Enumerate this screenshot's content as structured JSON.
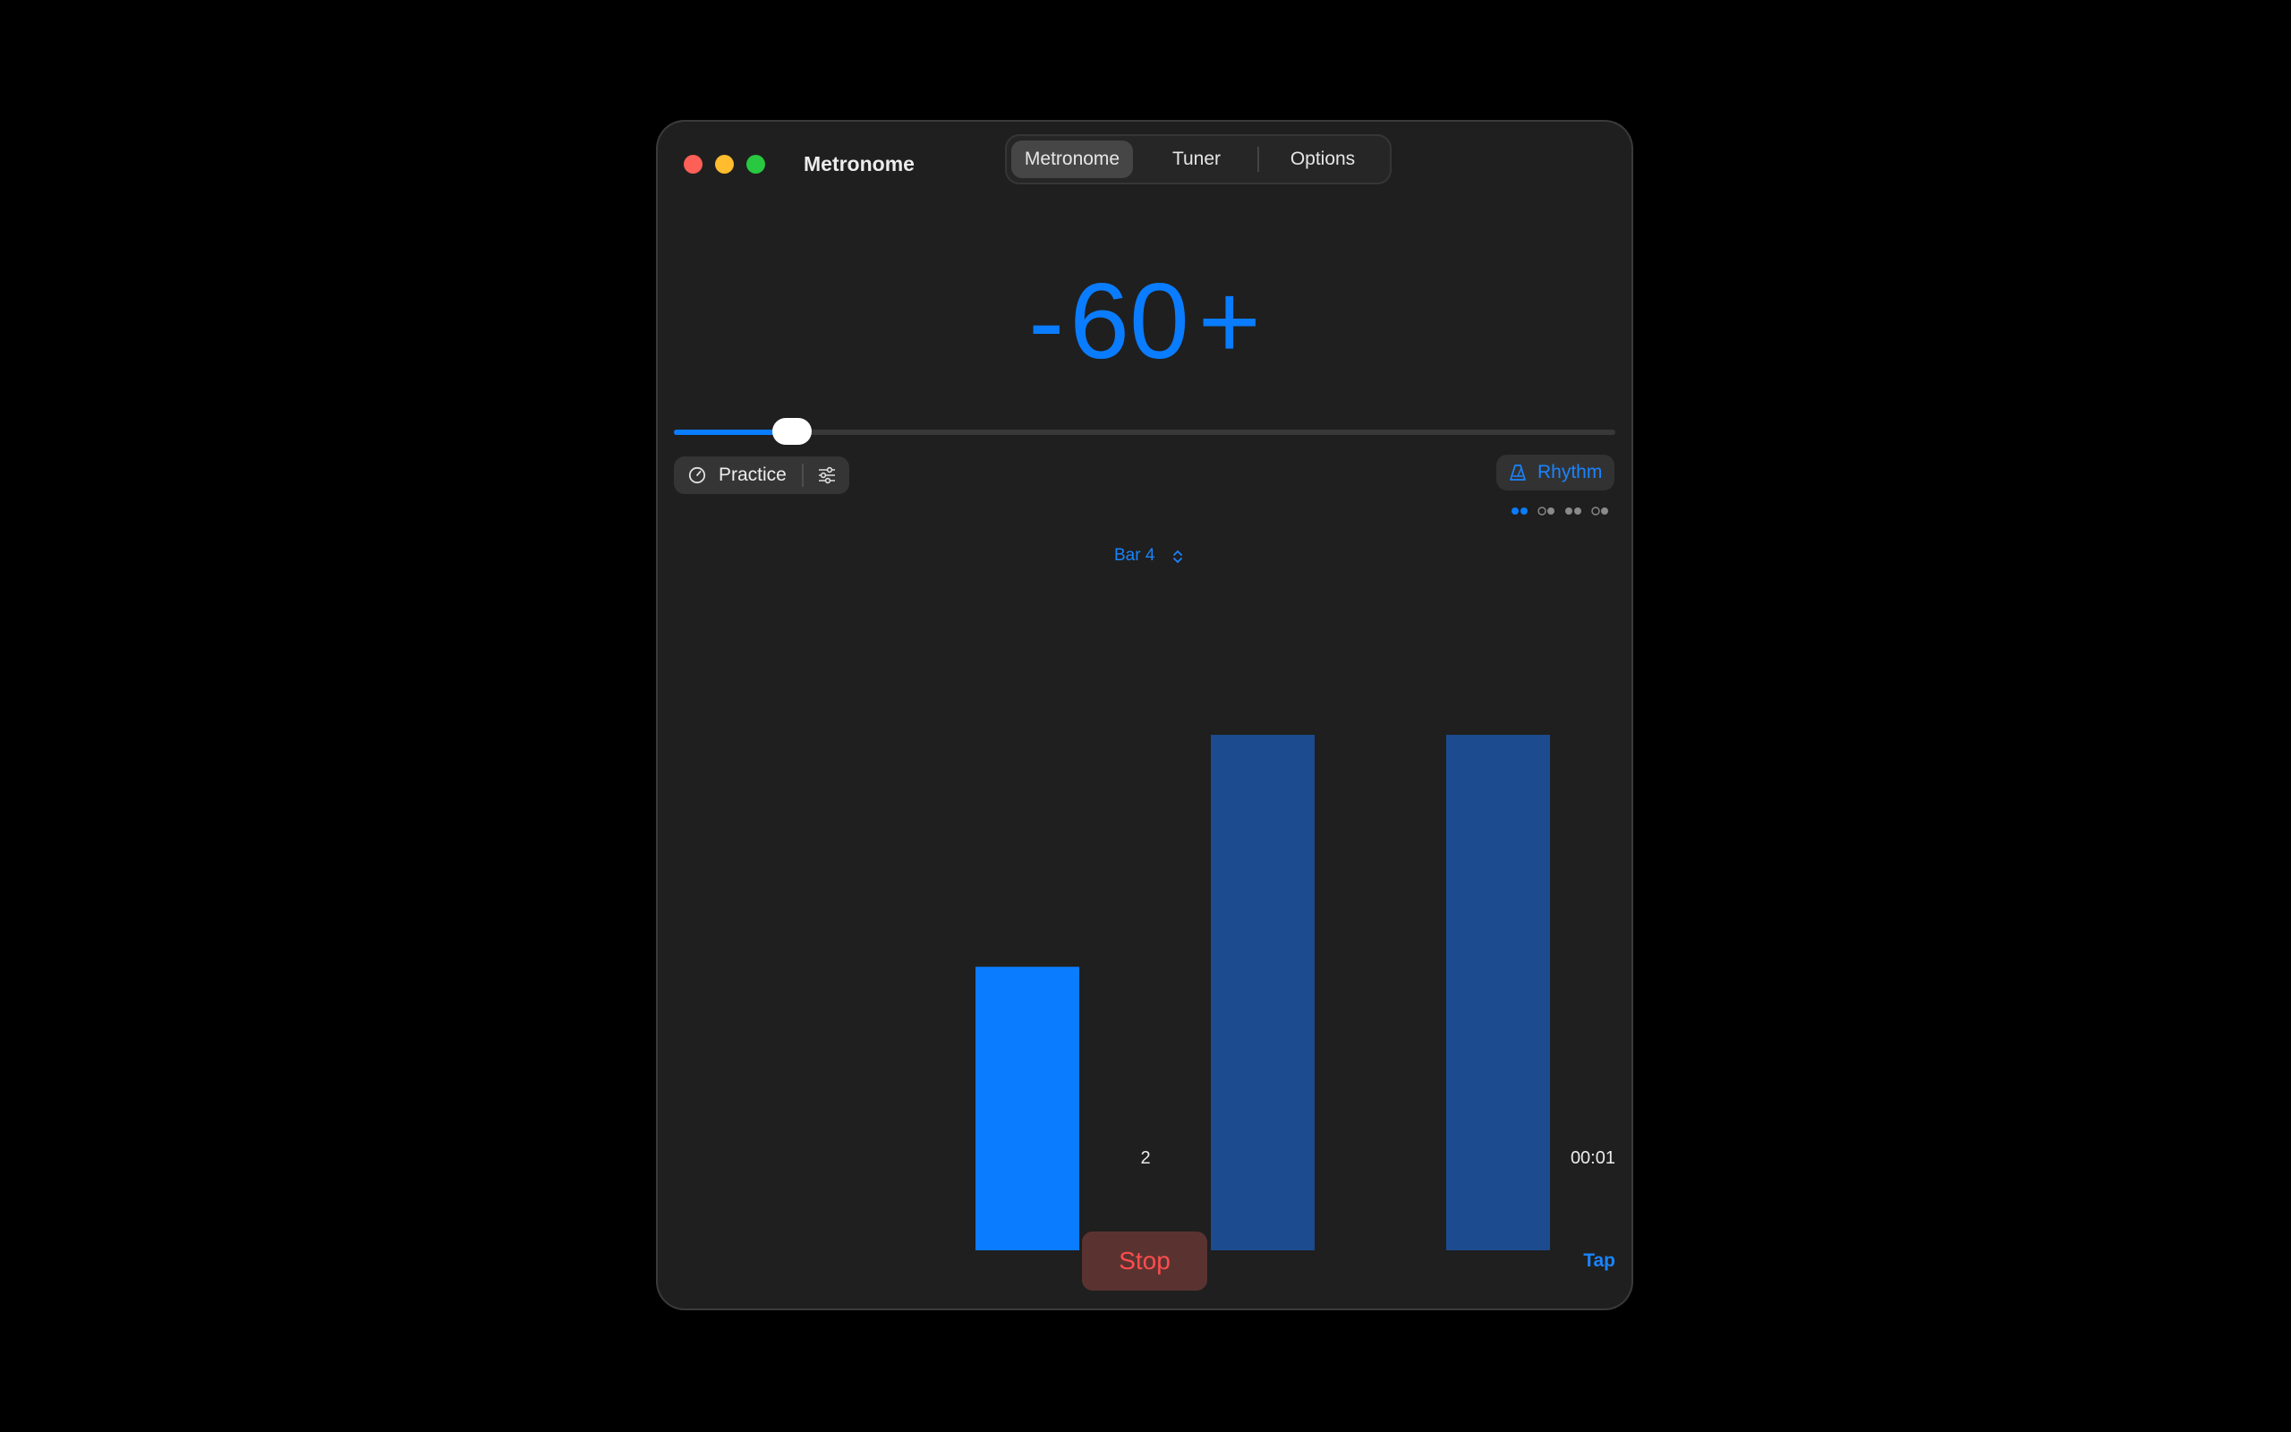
{
  "window": {
    "title": "Metronome",
    "tabs": [
      {
        "label": "Metronome",
        "active": true
      },
      {
        "label": "Tuner",
        "active": false
      },
      {
        "label": "Options",
        "active": false
      }
    ]
  },
  "tempo": {
    "minus_label": "-",
    "bpm": "60",
    "plus_label": "+",
    "slider_fraction": 0.125,
    "accent_color": "#0a7cff"
  },
  "practice": {
    "label": "Practice",
    "icon": "gauge-icon",
    "settings_icon": "sliders-icon"
  },
  "rhythm": {
    "label": "Rhythm",
    "icon": "metronome-icon",
    "pattern_dots": [
      "filled",
      "filled",
      "outline",
      "filled",
      "filled",
      "filled",
      "outline",
      "filled"
    ]
  },
  "bar_selector": {
    "label": "Bar 4"
  },
  "beats": {
    "levels": [
      0.55,
      1.0,
      1.0
    ],
    "active_index": 0,
    "active_color": "#0a7cff",
    "inactive_color": "#1c4b8f"
  },
  "status": {
    "current_beat": "2",
    "elapsed": "00:01"
  },
  "controls": {
    "stop_label": "Stop",
    "tap_label": "Tap"
  }
}
